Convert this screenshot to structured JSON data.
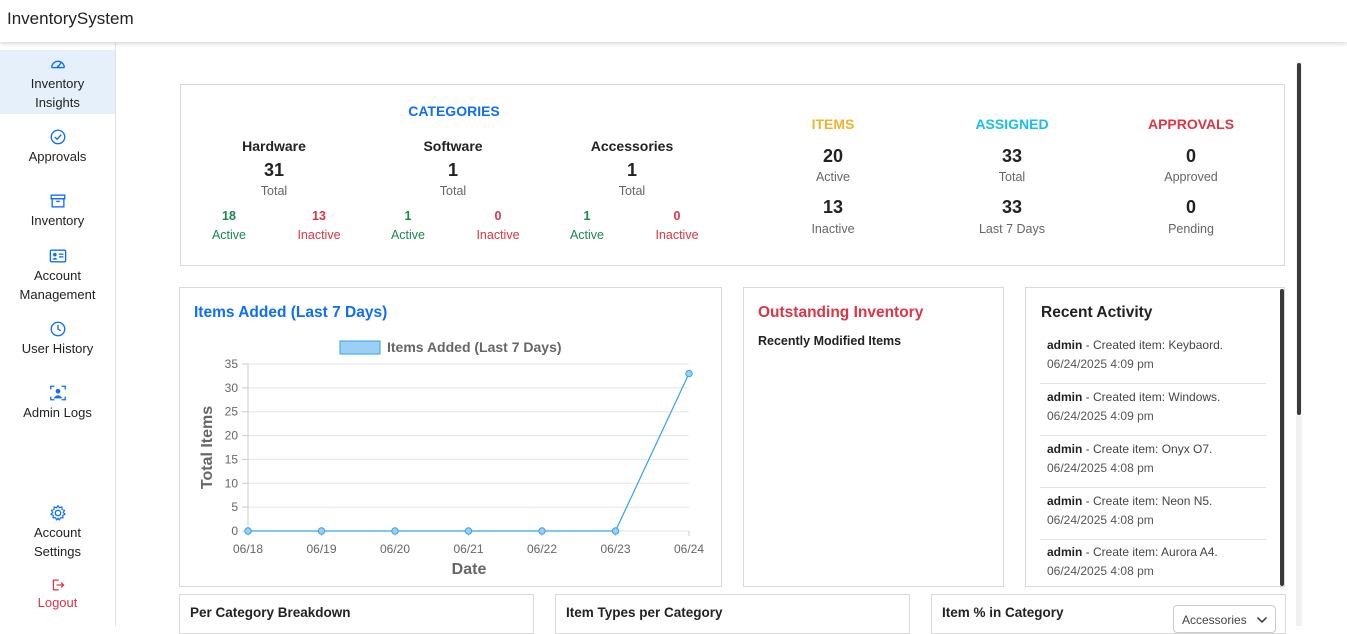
{
  "app": {
    "title": "InventorySystem"
  },
  "sidebar": {
    "items": [
      {
        "label_1": "Inventory",
        "label_2": "Insights",
        "icon": "speedometer-icon"
      },
      {
        "label_1": "Approvals",
        "icon": "check-circle-icon"
      },
      {
        "label_1": "Inventory",
        "icon": "archive-box-icon"
      },
      {
        "label_1": "Account",
        "label_2": "Management",
        "icon": "id-card-icon"
      },
      {
        "label_1": "User History",
        "icon": "clock-icon"
      },
      {
        "label_1": "Admin Logs",
        "icon": "user-scan-icon"
      }
    ],
    "settings": {
      "label_1": "Account",
      "label_2": "Settings",
      "icon": "gear-icon"
    },
    "logout": {
      "label": "Logout",
      "icon": "logout-icon"
    }
  },
  "summary": {
    "categories_title": "CATEGORIES",
    "categories": [
      {
        "name": "Hardware",
        "total": "31",
        "total_label": "Total",
        "active": "18",
        "active_label": "Active",
        "inactive": "13",
        "inactive_label": "Inactive"
      },
      {
        "name": "Software",
        "total": "1",
        "total_label": "Total",
        "active": "1",
        "active_label": "Active",
        "inactive": "0",
        "inactive_label": "Inactive"
      },
      {
        "name": "Accessories",
        "total": "1",
        "total_label": "Total",
        "active": "1",
        "active_label": "Active",
        "inactive": "0",
        "inactive_label": "Inactive"
      }
    ],
    "items": {
      "title": "ITEMS",
      "v1": "20",
      "l1": "Active",
      "v2": "13",
      "l2": "Inactive"
    },
    "assigned": {
      "title": "ASSIGNED",
      "v1": "33",
      "l1": "Total",
      "v2": "33",
      "l2": "Last 7 Days"
    },
    "approvals": {
      "title": "APPROVALS",
      "v1": "0",
      "l1": "Approved",
      "v2": "0",
      "l2": "Pending"
    }
  },
  "items_added": {
    "title": "Items Added (Last 7 Days)"
  },
  "chart_data": {
    "type": "line",
    "legend": "Items Added (Last 7 Days)",
    "x": [
      "06/18",
      "06/19",
      "06/20",
      "06/21",
      "06/22",
      "06/23",
      "06/24"
    ],
    "series": [
      {
        "name": "Items Added (Last 7 Days)",
        "values": [
          0,
          0,
          0,
          0,
          0,
          0,
          33
        ]
      }
    ],
    "xlabel": "Date",
    "ylabel": "Total Items",
    "ylim": [
      0,
      35
    ],
    "yticks": [
      0,
      5,
      10,
      15,
      20,
      25,
      30,
      35
    ],
    "grid": true,
    "legend_position": "top",
    "color": "#36a2eb",
    "fill": "#9ad0f5"
  },
  "outstanding": {
    "title": "Outstanding Inventory",
    "subtitle": "Recently Modified Items"
  },
  "activity": {
    "title": "Recent Activity",
    "entries": [
      {
        "user": "admin",
        "action": " - Created item: Keybaord.",
        "time": "06/24/2025 4:09 pm"
      },
      {
        "user": "admin",
        "action": " - Created item: Windows.",
        "time": "06/24/2025 4:09 pm"
      },
      {
        "user": "admin",
        "action": " - Create item: Onyx O7.",
        "time": "06/24/2025 4:08 pm"
      },
      {
        "user": "admin",
        "action": " - Create item: Neon N5.",
        "time": "06/24/2025 4:08 pm"
      },
      {
        "user": "admin",
        "action": " - Create item: Aurora A4.",
        "time": "06/24/2025 4:08 pm"
      }
    ]
  },
  "bottom_cards": {
    "per_category": "Per Category Breakdown",
    "item_types": "Item Types per Category",
    "item_pct": "Item % in Category",
    "category_select": "Accessories"
  }
}
